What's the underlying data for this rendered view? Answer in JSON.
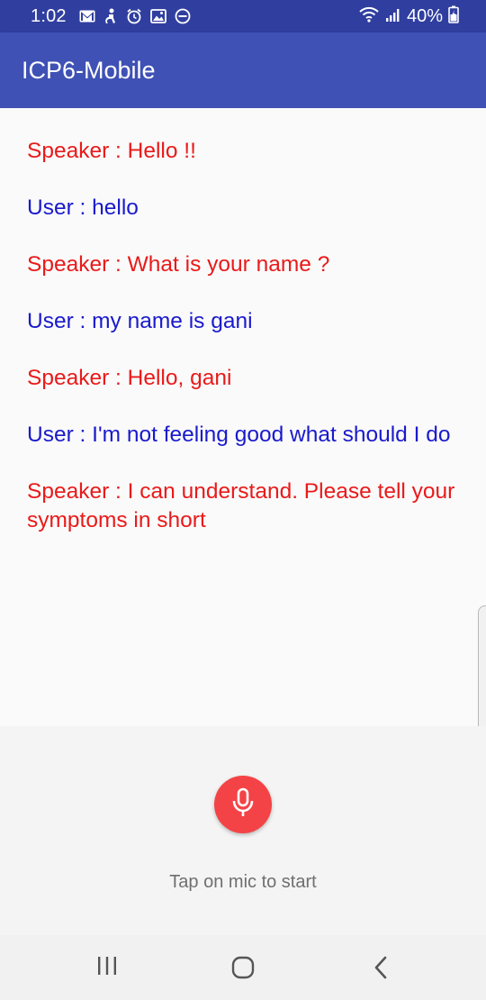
{
  "status_bar": {
    "time": "1:02",
    "battery": "40%",
    "icons": [
      "gmail-icon",
      "accessibility-icon",
      "alarm-icon",
      "gallery-icon",
      "do-not-disturb-icon",
      "wifi-icon",
      "signal-icon",
      "battery-icon"
    ]
  },
  "app_bar": {
    "title": "ICP6-Mobile"
  },
  "conversation": {
    "messages": [
      {
        "role": "speaker",
        "text": "Speaker : Hello !!"
      },
      {
        "role": "user",
        "text": "User : hello"
      },
      {
        "role": "speaker",
        "text": "Speaker : What is your name ?"
      },
      {
        "role": "user",
        "text": "User : my name is gani"
      },
      {
        "role": "speaker",
        "text": "Speaker : Hello, gani"
      },
      {
        "role": "user",
        "text": "User : I'm not feeling good what should I do"
      },
      {
        "role": "speaker",
        "text": "Speaker : I can understand. Please tell your symptoms in short"
      }
    ]
  },
  "mic_panel": {
    "icon": "microphone-icon",
    "hint": "Tap on mic to start"
  },
  "nav_bar": {
    "icons": [
      "recent-apps-icon",
      "home-icon",
      "back-icon"
    ]
  },
  "colors": {
    "status_bar": "#303f9f",
    "app_bar": "#3f51b5",
    "speaker_text": "#e91a1a",
    "user_text": "#1a1acc",
    "mic_button": "#f44346"
  }
}
